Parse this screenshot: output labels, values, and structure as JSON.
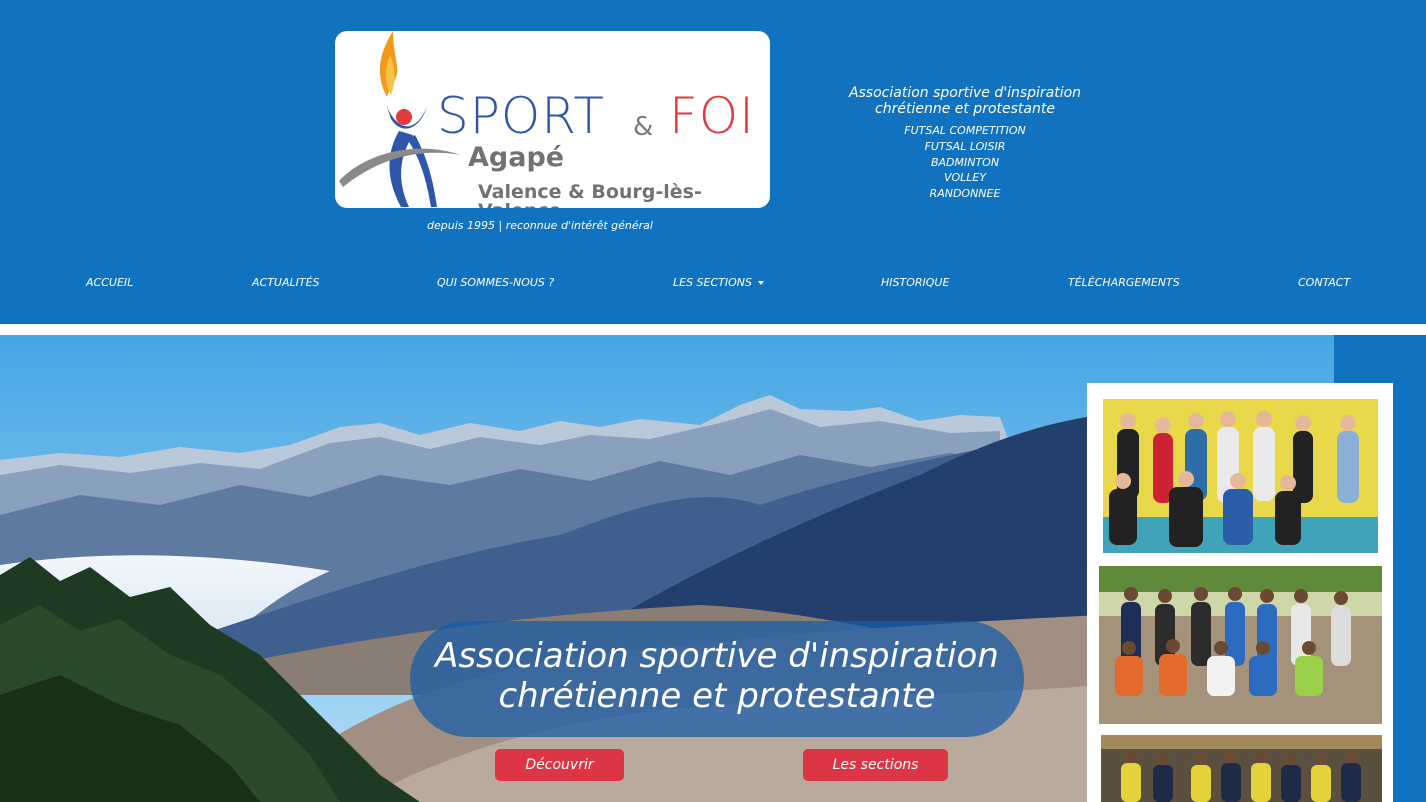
{
  "brand": {
    "logo_word_1": "SPORT",
    "logo_amp": "&",
    "logo_word_2": "FOI",
    "logo_name": "Agapé",
    "logo_city": "Valence & Bourg-lès-Valence",
    "tagline": "depuis 1995 | reconnue d'intérêt général"
  },
  "header_info": {
    "assoc_line_1": "Association sportive d'inspiration",
    "assoc_line_2": "chrétienne et protestante",
    "sections": [
      "FUTSAL COMPETITION",
      "FUTSAL LOISIR",
      "BADMINTON",
      "VOLLEY",
      "RANDONNEE"
    ]
  },
  "nav": {
    "items": [
      "ACCUEIL",
      "ACTUALITÉS",
      "QUI SOMMES-NOUS ?",
      "LES SECTIONS",
      "HISTORIQUE",
      "TÉLÉCHARGEMENTS",
      "CONTACT"
    ]
  },
  "hero": {
    "line_1": "Association sportive d'inspiration",
    "line_2": "chrétienne et protestante",
    "discover_label": "Découvrir",
    "sections_label": "Les sections"
  },
  "colors": {
    "brand_blue": "#1173c0",
    "button_red": "#dc3545",
    "logo_blue": "#2f56a8",
    "logo_red": "#e23a3a"
  }
}
